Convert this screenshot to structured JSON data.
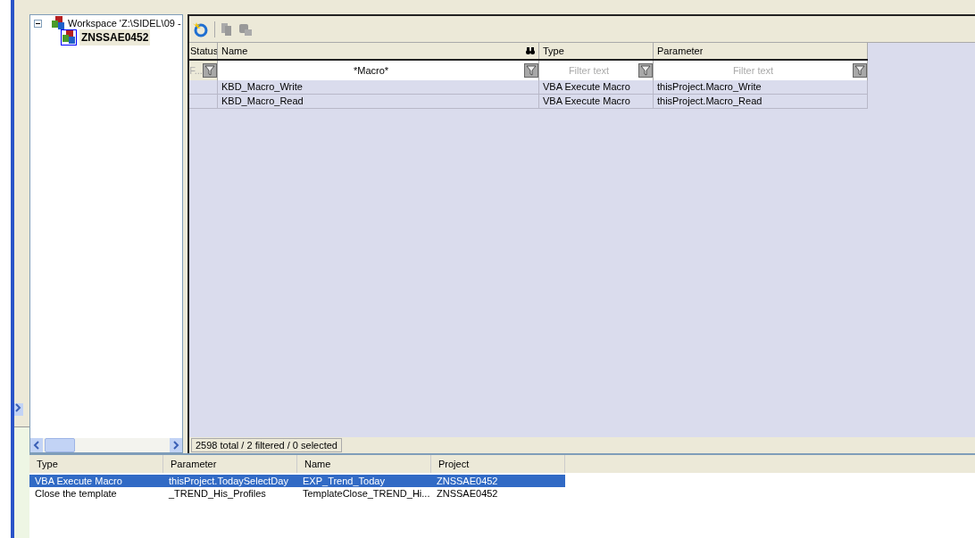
{
  "tree": {
    "label": "Workspace 'Z:\\SIDEL\\09 -",
    "expanded": true,
    "children": [
      {
        "label": "ZNSSAE0452",
        "selected": true
      }
    ]
  },
  "grid": {
    "columns": [
      "Status",
      "Name",
      "Type",
      "Parameter"
    ],
    "filters": [
      {
        "placeholder": "F..."
      },
      {
        "value": "*Macro*"
      },
      {
        "placeholder": "Filter text"
      },
      {
        "placeholder": "Filter text"
      }
    ],
    "rows": [
      {
        "name": "KBD_Macro_Write",
        "type": "VBA Execute Macro",
        "parameter": "thisProject.Macro_Write"
      },
      {
        "name": "KBD_Macro_Read",
        "type": "VBA Execute Macro",
        "parameter": "thisProject.Macro_Read"
      }
    ],
    "status_text": "2598 total / 2 filtered / 0 selected"
  },
  "list": {
    "columns": [
      "Type",
      "Parameter",
      "Name",
      "Project"
    ],
    "rows": [
      {
        "selected": true,
        "cells": [
          "VBA Execute Macro",
          "thisProject.TodaySelectDay",
          "EXP_Trend_Today",
          "ZNSSAE0452"
        ]
      },
      {
        "selected": false,
        "cells": [
          "Close the template",
          "_TREND_His_Profiles",
          "TemplateClose_TREND_Hi...",
          "ZNSSAE0452"
        ]
      }
    ]
  }
}
